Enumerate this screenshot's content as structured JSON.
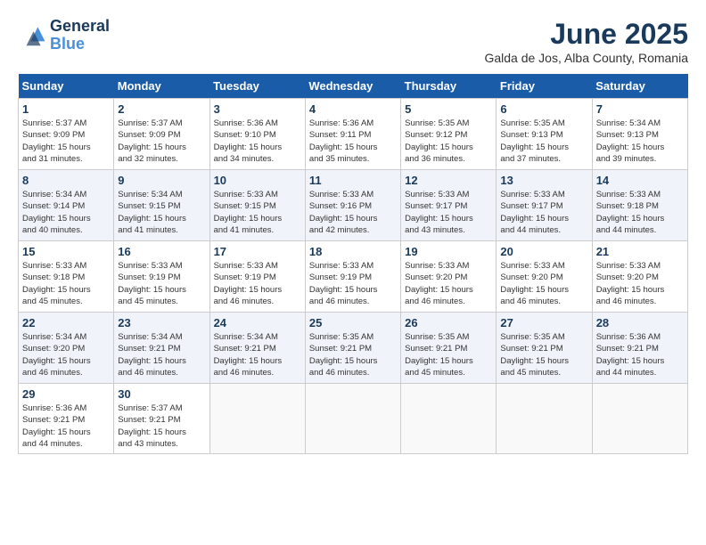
{
  "logo": {
    "line1": "General",
    "line2": "Blue"
  },
  "title": {
    "month_year": "June 2025",
    "location": "Galda de Jos, Alba County, Romania"
  },
  "weekdays": [
    "Sunday",
    "Monday",
    "Tuesday",
    "Wednesday",
    "Thursday",
    "Friday",
    "Saturday"
  ],
  "weeks": [
    [
      {
        "day": "1",
        "sunrise": "5:37 AM",
        "sunset": "9:09 PM",
        "daylight": "15 hours and 31 minutes."
      },
      {
        "day": "2",
        "sunrise": "5:37 AM",
        "sunset": "9:09 PM",
        "daylight": "15 hours and 32 minutes."
      },
      {
        "day": "3",
        "sunrise": "5:36 AM",
        "sunset": "9:10 PM",
        "daylight": "15 hours and 34 minutes."
      },
      {
        "day": "4",
        "sunrise": "5:36 AM",
        "sunset": "9:11 PM",
        "daylight": "15 hours and 35 minutes."
      },
      {
        "day": "5",
        "sunrise": "5:35 AM",
        "sunset": "9:12 PM",
        "daylight": "15 hours and 36 minutes."
      },
      {
        "day": "6",
        "sunrise": "5:35 AM",
        "sunset": "9:13 PM",
        "daylight": "15 hours and 37 minutes."
      },
      {
        "day": "7",
        "sunrise": "5:34 AM",
        "sunset": "9:13 PM",
        "daylight": "15 hours and 39 minutes."
      }
    ],
    [
      {
        "day": "8",
        "sunrise": "5:34 AM",
        "sunset": "9:14 PM",
        "daylight": "15 hours and 40 minutes."
      },
      {
        "day": "9",
        "sunrise": "5:34 AM",
        "sunset": "9:15 PM",
        "daylight": "15 hours and 41 minutes."
      },
      {
        "day": "10",
        "sunrise": "5:33 AM",
        "sunset": "9:15 PM",
        "daylight": "15 hours and 41 minutes."
      },
      {
        "day": "11",
        "sunrise": "5:33 AM",
        "sunset": "9:16 PM",
        "daylight": "15 hours and 42 minutes."
      },
      {
        "day": "12",
        "sunrise": "5:33 AM",
        "sunset": "9:17 PM",
        "daylight": "15 hours and 43 minutes."
      },
      {
        "day": "13",
        "sunrise": "5:33 AM",
        "sunset": "9:17 PM",
        "daylight": "15 hours and 44 minutes."
      },
      {
        "day": "14",
        "sunrise": "5:33 AM",
        "sunset": "9:18 PM",
        "daylight": "15 hours and 44 minutes."
      }
    ],
    [
      {
        "day": "15",
        "sunrise": "5:33 AM",
        "sunset": "9:18 PM",
        "daylight": "15 hours and 45 minutes."
      },
      {
        "day": "16",
        "sunrise": "5:33 AM",
        "sunset": "9:19 PM",
        "daylight": "15 hours and 45 minutes."
      },
      {
        "day": "17",
        "sunrise": "5:33 AM",
        "sunset": "9:19 PM",
        "daylight": "15 hours and 46 minutes."
      },
      {
        "day": "18",
        "sunrise": "5:33 AM",
        "sunset": "9:19 PM",
        "daylight": "15 hours and 46 minutes."
      },
      {
        "day": "19",
        "sunrise": "5:33 AM",
        "sunset": "9:20 PM",
        "daylight": "15 hours and 46 minutes."
      },
      {
        "day": "20",
        "sunrise": "5:33 AM",
        "sunset": "9:20 PM",
        "daylight": "15 hours and 46 minutes."
      },
      {
        "day": "21",
        "sunrise": "5:33 AM",
        "sunset": "9:20 PM",
        "daylight": "15 hours and 46 minutes."
      }
    ],
    [
      {
        "day": "22",
        "sunrise": "5:34 AM",
        "sunset": "9:20 PM",
        "daylight": "15 hours and 46 minutes."
      },
      {
        "day": "23",
        "sunrise": "5:34 AM",
        "sunset": "9:21 PM",
        "daylight": "15 hours and 46 minutes."
      },
      {
        "day": "24",
        "sunrise": "5:34 AM",
        "sunset": "9:21 PM",
        "daylight": "15 hours and 46 minutes."
      },
      {
        "day": "25",
        "sunrise": "5:35 AM",
        "sunset": "9:21 PM",
        "daylight": "15 hours and 46 minutes."
      },
      {
        "day": "26",
        "sunrise": "5:35 AM",
        "sunset": "9:21 PM",
        "daylight": "15 hours and 45 minutes."
      },
      {
        "day": "27",
        "sunrise": "5:35 AM",
        "sunset": "9:21 PM",
        "daylight": "15 hours and 45 minutes."
      },
      {
        "day": "28",
        "sunrise": "5:36 AM",
        "sunset": "9:21 PM",
        "daylight": "15 hours and 44 minutes."
      }
    ],
    [
      {
        "day": "29",
        "sunrise": "5:36 AM",
        "sunset": "9:21 PM",
        "daylight": "15 hours and 44 minutes."
      },
      {
        "day": "30",
        "sunrise": "5:37 AM",
        "sunset": "9:21 PM",
        "daylight": "15 hours and 43 minutes."
      },
      null,
      null,
      null,
      null,
      null
    ]
  ],
  "labels": {
    "sunrise": "Sunrise:",
    "sunset": "Sunset:",
    "daylight": "Daylight:"
  }
}
